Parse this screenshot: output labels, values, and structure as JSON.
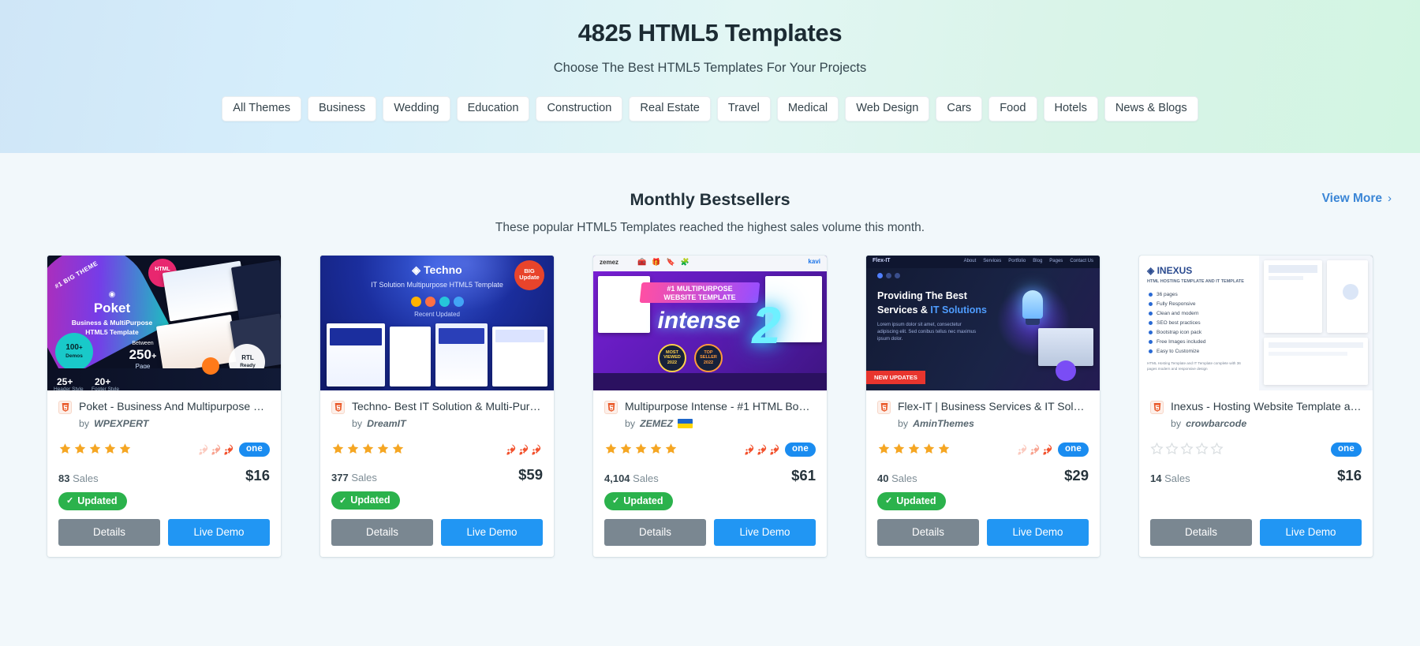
{
  "hero": {
    "title": "4825 HTML5 Templates",
    "subtitle": "Choose The Best HTML5 Templates For Your Projects",
    "tabs": [
      {
        "label": "All Themes"
      },
      {
        "label": "Business"
      },
      {
        "label": "Wedding"
      },
      {
        "label": "Education"
      },
      {
        "label": "Construction"
      },
      {
        "label": "Real Estate"
      },
      {
        "label": "Travel"
      },
      {
        "label": "Medical"
      },
      {
        "label": "Web Design"
      },
      {
        "label": "Cars"
      },
      {
        "label": "Food"
      },
      {
        "label": "Hotels"
      },
      {
        "label": "News & Blogs"
      }
    ]
  },
  "section": {
    "title": "Monthly Bestsellers",
    "subtitle": "These popular HTML5 Templates reached the highest sales volume this month.",
    "view_more": "View More",
    "view_more_chevron": "›"
  },
  "labels": {
    "by": "by",
    "sales": "Sales",
    "updated": "Updated",
    "updated_check": "✓",
    "details": "Details",
    "live_demo": "Live Demo",
    "one_badge": "one"
  },
  "colors": {
    "accent_blue": "#2196f3",
    "link_blue": "#3b86d6",
    "star_gold": "#f5a623",
    "star_empty": "#d8dde0",
    "updated_green": "#2bb24c",
    "details_gray": "#7a8791",
    "one_blue": "#1a8cf0",
    "rocket_orange": "#f2522e"
  },
  "cards": [
    {
      "title": "Poket - Business And Multipurpose Re...",
      "author": "WPEXPERT",
      "flag": false,
      "stars": 5,
      "rockets": 3,
      "rockets_filled": 1,
      "has_one": true,
      "sales": "83",
      "price": "$16",
      "updated": true,
      "thumb": {
        "name": "Poket",
        "tagline1": "Business & MultiPurpose",
        "tagline2": "HTML5 Template",
        "ribbon": "#1 BIG THEME",
        "pill1": "HTML",
        "pill2": "RTL Ready",
        "badge_demos": "100+ Demos",
        "badge_pages": "250 + Page",
        "stat1": "25+",
        "stat1_sub": "Header Style",
        "stat2": "20+",
        "stat2_sub": "Footer Style",
        "between": "Between"
      }
    },
    {
      "title": "Techno- Best IT Solution & Multi-Purp...",
      "author": "DreamIT",
      "flag": false,
      "stars": 5,
      "rockets": 3,
      "rockets_filled": 3,
      "has_one": false,
      "sales": "377",
      "price": "$59",
      "updated": true,
      "thumb": {
        "name": "Techno",
        "tagline1": "IT Solution Multipurpose HTML5 Template",
        "tagline2": "Recent Updated",
        "pill1": "BIG Update"
      }
    },
    {
      "title": "Multipurpose Intense - #1 HTML Boot...",
      "author": "ZEMEZ",
      "flag": true,
      "stars": 5,
      "rockets": 3,
      "rockets_filled": 3,
      "has_one": true,
      "sales": "4,104",
      "price": "$61",
      "updated": true,
      "thumb": {
        "name": "intense",
        "big": "2",
        "tagline1": "#1 MULTIPURPOSE",
        "tagline2": "WEBSITE TEMPLATE",
        "badge1": "MOST VIEWED 2022",
        "badge2": "TOP SELLER 2022",
        "brand": "zemez"
      }
    },
    {
      "title": "Flex-IT | Business Services & IT Solutio...",
      "author": "AminThemes",
      "flag": false,
      "stars": 5,
      "rockets": 3,
      "rockets_filled": 1,
      "has_one": true,
      "sales": "40",
      "price": "$29",
      "updated": true,
      "thumb": {
        "tagline1": "Providing The Best",
        "tagline2": "Services & IT Solutions",
        "ribbon": "NEW UPDATES",
        "brand": "Flex-IT"
      }
    },
    {
      "title": "Inexus - Hosting Website Template an...",
      "author": "crowbarcode",
      "flag": false,
      "stars": 0,
      "rockets": 0,
      "rockets_filled": 0,
      "has_one": true,
      "sales": "14",
      "price": "$16",
      "updated": false,
      "thumb": {
        "name": "INEXUS",
        "tagline1": "HTML HOSTING TEMPLATE AND IT TEMPLATE",
        "features": [
          "36 pages",
          "Fully Responsive",
          "Clean and modern",
          "SEO best practices",
          "Bootstrap icon pack",
          "Free Images included",
          "Easy to Customize"
        ],
        "footer": "HTML Hosting Template and IT Template complete with 36 pages modern and responsive design"
      }
    }
  ]
}
